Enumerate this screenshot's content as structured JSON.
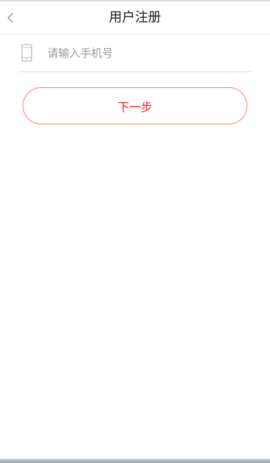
{
  "header": {
    "title": "用户注册",
    "back_icon": "chevron-left-icon"
  },
  "form": {
    "phone_icon": "mobile-phone-icon",
    "phone_placeholder": "请输入手机号",
    "phone_value": ""
  },
  "actions": {
    "next_label": "下一步"
  },
  "colors": {
    "accent_text": "#ee2222",
    "accent_border": "#f47b70",
    "placeholder": "#9a9a9a",
    "divider": "#dddddd"
  }
}
